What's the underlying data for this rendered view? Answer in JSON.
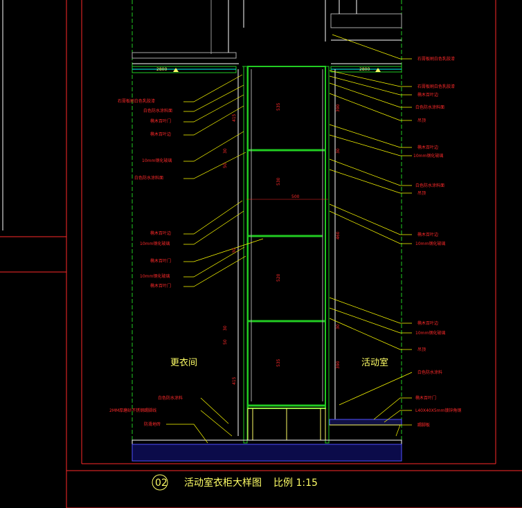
{
  "drawing": {
    "title": "活动室衣柜大样图",
    "scale": "比例 1:15",
    "number": "02"
  },
  "rooms": {
    "left": "更衣间",
    "right": "活动室"
  },
  "levels": {
    "left": "2800",
    "right": "2800"
  },
  "left_labels": [
    "石膏板刷白色乳胶漆",
    "白色防水涂料面",
    "椭木百叶门",
    "椭木百叶边",
    "10mm钢化玻璃",
    "白色防水涂料面",
    "椭木百叶边",
    "10mm钢化玻璃",
    "椭木百叶门",
    "10mm钢化玻璃",
    "椭木百叶门",
    "白色防水涂料",
    "2MM厚磨砂不锈钢踢脚线",
    "防滑地砖"
  ],
  "right_labels": [
    "石膏板刷白色乳胶漆",
    "石膏板刷白色乳胶漆",
    "椭木百叶边",
    "白色防水涂料面",
    "吊顶",
    "椭木百叶边",
    "10mm钢化玻璃",
    "白色防水涂料面",
    "吊顶",
    "椭木百叶边",
    "10mm钢化玻璃",
    "椭木百叶边",
    "10mm钢化玻璃",
    "吊顶",
    "白色防水涂料",
    "椭木百叶门",
    "L40X40X5mm镀锌角钢",
    "踢脚板"
  ],
  "dimensions": {
    "width": "500",
    "inner_heights": [
      "535",
      "530",
      "520",
      "535"
    ],
    "left_heights": [
      "415",
      "30",
      "50",
      "30",
      "30",
      "50",
      "415"
    ],
    "right_heights": [
      "390",
      "30",
      "460",
      "30",
      "390"
    ]
  },
  "colors": {
    "background": "#000000",
    "frame": "#ff2a2a",
    "cabinet": "#22cc22",
    "leader": "#ffff00",
    "panel": "#ffffff",
    "floor": "#4f4fff",
    "accent": "#00ffff"
  }
}
